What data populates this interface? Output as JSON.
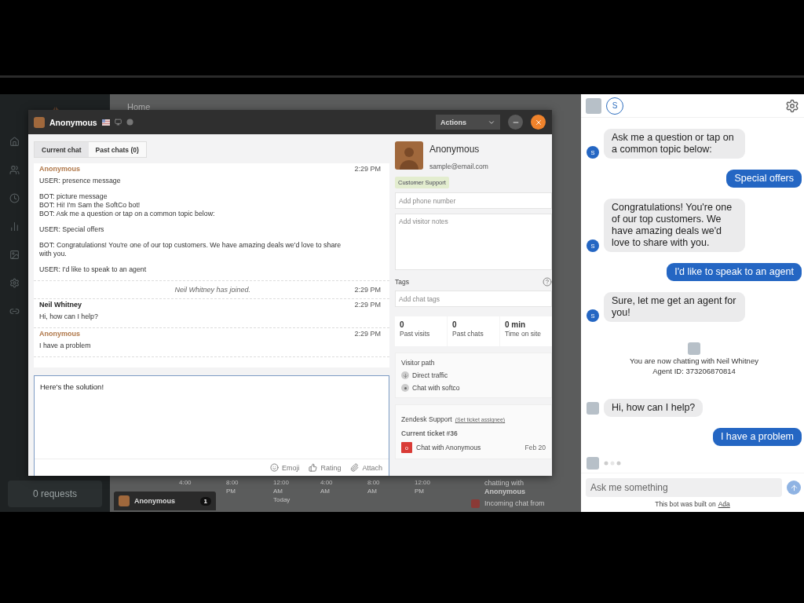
{
  "background_app": {
    "page_title": "Home",
    "requests": "0 requests",
    "timeline": [
      {
        "lines": [
          "4:00"
        ]
      },
      {
        "lines": [
          "8:00",
          "PM"
        ]
      },
      {
        "lines": [
          "12:00",
          "AM",
          "Today"
        ]
      },
      {
        "lines": [
          "4:00",
          "AM"
        ]
      },
      {
        "lines": [
          "8:00",
          "AM"
        ]
      },
      {
        "lines": [
          "12:00",
          "PM"
        ]
      }
    ],
    "activity": [
      {
        "kind": "chat_started",
        "lines": [
          "chatting with",
          "**Anonymous**"
        ]
      },
      {
        "kind": "incoming",
        "lines": [
          "Incoming chat from"
        ]
      }
    ],
    "taskbar_chat": {
      "name": "Anonymous",
      "count": "1"
    }
  },
  "chat_window": {
    "title": "Anonymous",
    "actions_label": "Actions",
    "tabs": [
      {
        "label": "Current chat",
        "selected": true
      },
      {
        "label": "Past chats (0)",
        "selected": false
      }
    ],
    "transcript": [
      {
        "kind": "message",
        "color": "#b0784a",
        "sender": "Anonymous",
        "time": "2:29 PM",
        "paragraphs": [
          [
            "USER: presence message"
          ],
          [
            "BOT: picture message",
            "BOT: Hi! I'm Sam the SoftCo bot!",
            "BOT: Ask me a question or tap on a common topic below:"
          ],
          [
            "USER: Special offers"
          ],
          [
            "BOT: Congratulations! You're one of our top customers. We have amazing deals we'd love to share with you."
          ],
          [
            "USER: I'd like to speak to an agent"
          ]
        ]
      },
      {
        "kind": "event",
        "text": "Neil Whitney has joined.",
        "time": "2:29 PM"
      },
      {
        "kind": "message",
        "color": "#222222",
        "sender": "Neil Whitney",
        "time": "2:29 PM",
        "paragraphs": [
          [
            "Hi, how can I help?"
          ]
        ]
      },
      {
        "kind": "message",
        "color": "#b0784a",
        "sender": "Anonymous",
        "time": "2:29 PM",
        "paragraphs": [
          [
            "I have a problem"
          ]
        ]
      }
    ],
    "composer": {
      "value": "Here's the solution!",
      "tools": [
        {
          "kind": "emoji",
          "label": "Emoji"
        },
        {
          "kind": "rating",
          "label": "Rating"
        },
        {
          "kind": "attach",
          "label": "Attach"
        }
      ]
    },
    "visitor": {
      "name": "Anonymous",
      "email": "sample@email.com",
      "department": "Customer Support",
      "phone_placeholder": "Add phone number",
      "notes_placeholder": "Add visitor notes",
      "tags_label": "Tags",
      "tags_placeholder": "Add chat tags",
      "stats": [
        {
          "value": "0",
          "label": "Past visits"
        },
        {
          "value": "0",
          "label": "Past chats"
        },
        {
          "value": "0 min",
          "label": "Time on site"
        }
      ],
      "path_title": "Visitor path",
      "path": [
        {
          "kind": "referrer",
          "text": "Direct traffic"
        },
        {
          "kind": "chat",
          "text": "Chat with softco"
        }
      ],
      "zendesk": {
        "title": "Zendesk Support",
        "link": "(Set ticket assignee)",
        "ticket_heading": "Current ticket #36",
        "ticket": {
          "status_letter": "o",
          "subject": "Chat with Anonymous",
          "date": "Feb 20"
        }
      }
    }
  },
  "bot_widget": {
    "bot_badge": "S",
    "messages": [
      {
        "kind": "bot",
        "avatar_letter": "S",
        "text": "Ask me a question or tap on a common topic below:"
      },
      {
        "kind": "user",
        "text": "Special offers"
      },
      {
        "kind": "bot",
        "avatar_letter": "S",
        "text": "Congratulations!  You're one of our top customers.  We have amazing deals we'd love to share with you."
      },
      {
        "kind": "user",
        "text": "I'd like to speak to an agent"
      },
      {
        "kind": "bot",
        "avatar_letter": "S",
        "text": "Sure, let me get an agent for you!"
      },
      {
        "kind": "handoff",
        "lines": [
          "You are now chatting with Neil Whitney",
          "Agent ID: 373206870814"
        ]
      },
      {
        "kind": "agent",
        "text": "Hi, how can I help?"
      },
      {
        "kind": "user",
        "text": "I have a problem"
      },
      {
        "kind": "typing"
      }
    ],
    "input_placeholder": "Ask me something",
    "footer": "This bot was built on",
    "footer_link": "Ada"
  }
}
